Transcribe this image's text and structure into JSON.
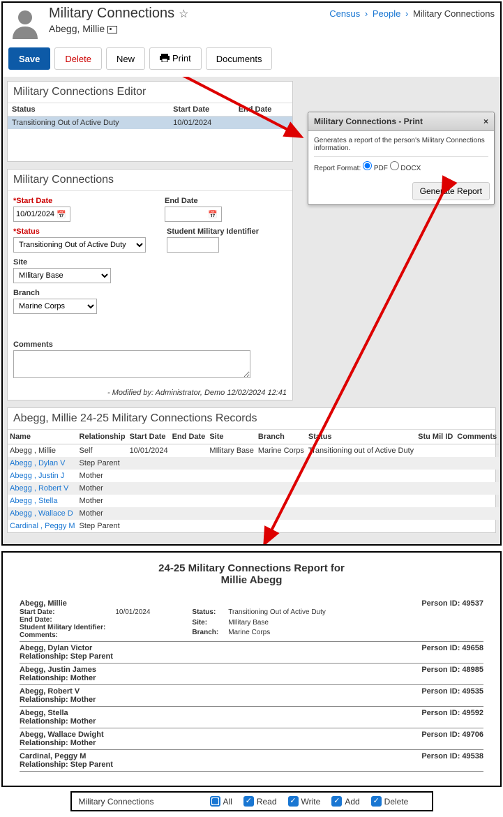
{
  "breadcrumb": {
    "a": "Census",
    "b": "People",
    "c": "Military Connections"
  },
  "page": {
    "title": "Military Connections",
    "person": "Abegg, Millie"
  },
  "buttons": {
    "save": "Save",
    "delete": "Delete",
    "new": "New",
    "print": "Print",
    "documents": "Documents"
  },
  "editor": {
    "title": "Military Connections Editor",
    "cols": {
      "status": "Status",
      "start": "Start Date",
      "end": "End Date"
    },
    "row": {
      "status": "Transitioning Out of Active Duty",
      "start": "10/01/2024",
      "end": ""
    }
  },
  "form": {
    "title": "Military Connections",
    "labels": {
      "start": "*Start Date",
      "end": "End Date",
      "status": "*Status",
      "smi": "Student Military Identifier",
      "site": "Site",
      "branch": "Branch",
      "comments": "Comments"
    },
    "values": {
      "start": "10/01/2024",
      "end": "",
      "status": "Transitioning Out of Active Duty",
      "smi": "",
      "site": "MIlitary Base",
      "branch": "Marine Corps",
      "comments": ""
    },
    "modified": "- Modified by: Administrator, Demo 12/02/2024 12:41"
  },
  "printDialog": {
    "title": "Military Connections - Print",
    "desc": "Generates a report of the person's Military Connections information.",
    "formatLabel": "Report Format:",
    "pdf": "PDF",
    "docx": "DOCX",
    "button": "Generate Report"
  },
  "records": {
    "title": "Abegg, Millie 24-25 Military Connections Records",
    "cols": {
      "name": "Name",
      "rel": "Relationship",
      "start": "Start Date",
      "end": "End Date",
      "site": "Site",
      "branch": "Branch",
      "status": "Status",
      "smi": "Stu Mil ID",
      "comments": "Comments"
    },
    "rows": [
      {
        "name": "Abegg , Millie",
        "rel": "Self",
        "start": "10/01/2024",
        "end": "",
        "site": "MIlitary Base",
        "branch": "Marine Corps",
        "status": "Transitioning out of Active Duty",
        "link": false
      },
      {
        "name": "Abegg , Dylan V",
        "rel": "Step Parent",
        "link": true
      },
      {
        "name": "Abegg , Justin J",
        "rel": "Mother",
        "link": true
      },
      {
        "name": "Abegg , Robert V",
        "rel": "Mother",
        "link": true
      },
      {
        "name": "Abegg , Stella",
        "rel": "Mother",
        "link": true
      },
      {
        "name": "Abegg , Wallace D",
        "rel": "Mother",
        "link": true
      },
      {
        "name": "Cardinal , Peggy M",
        "rel": "Step Parent",
        "link": true
      }
    ]
  },
  "report": {
    "title1": "24-25 Military Connections Report for",
    "title2": "Millie Abegg",
    "main": {
      "name": "Abegg, Millie",
      "pid": "Person ID: 49537",
      "start": "10/01/2024",
      "end": "",
      "smi": "",
      "comments": "",
      "status": "Transitioning Out of Active Duty",
      "site": "MIlitary Base",
      "branch": "Marine Corps"
    },
    "rows": [
      {
        "name": "Abegg, Dylan Victor",
        "rel": "Relationship: Step Parent",
        "pid": "Person ID: 49658"
      },
      {
        "name": "Abegg, Justin James",
        "rel": "Relationship: Mother",
        "pid": "Person ID: 48985"
      },
      {
        "name": "Abegg, Robert V",
        "rel": "Relationship: Mother",
        "pid": "Person ID: 49535"
      },
      {
        "name": "Abegg, Stella",
        "rel": "Relationship: Mother",
        "pid": "Person ID: 49592"
      },
      {
        "name": "Abegg, Wallace Dwight",
        "rel": "Relationship: Mother",
        "pid": "Person ID: 49706"
      },
      {
        "name": "Cardinal, Peggy M",
        "rel": "Relationship: Step Parent",
        "pid": "Person ID: 49538"
      }
    ],
    "labels": {
      "start": "Start Date:",
      "end": "End Date:",
      "smi": "Student Military Identifier:",
      "comments": "Comments:",
      "status": "Status:",
      "site": "Site:",
      "branch": "Branch:"
    }
  },
  "perm": {
    "title": "Military Connections",
    "all": "All",
    "read": "Read",
    "write": "Write",
    "add": "Add",
    "delete": "Delete"
  }
}
